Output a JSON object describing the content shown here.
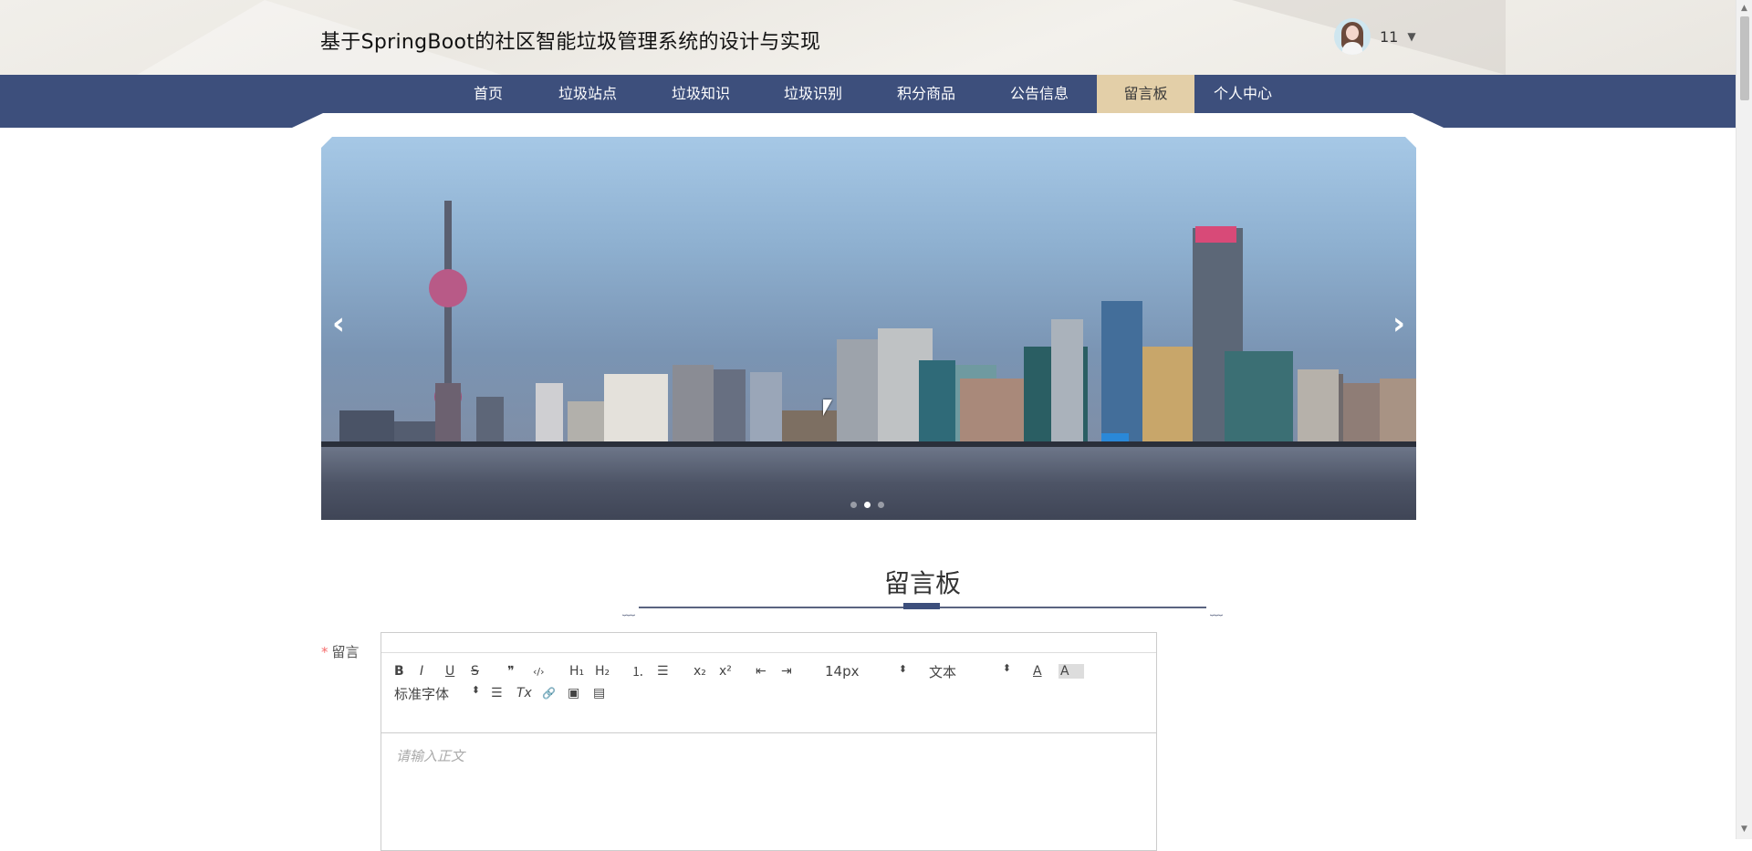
{
  "header": {
    "site_title": "基于SpringBoot的社区智能垃圾管理系统的设计与实现",
    "user_name": "11",
    "caret": "▼"
  },
  "nav": {
    "items": [
      {
        "label": "首页"
      },
      {
        "label": "垃圾站点"
      },
      {
        "label": "垃圾知识"
      },
      {
        "label": "垃圾识别"
      },
      {
        "label": "积分商品"
      },
      {
        "label": "公告信息"
      },
      {
        "label": "留言板",
        "active": true
      },
      {
        "label": "个人中心"
      }
    ]
  },
  "carousel": {
    "prev": "‹",
    "next": "›",
    "slide_count": 3,
    "active_index": 1
  },
  "section": {
    "title": "留言板"
  },
  "form": {
    "label_required": "*",
    "label": "留言",
    "editor": {
      "placeholder": "请输入正文",
      "toolbar_row1": {
        "bold": "B",
        "italic": "I",
        "underline": "U",
        "strike": "S",
        "quote": "❞",
        "code": "‹/›",
        "h1": "H₁",
        "h2": "H₂",
        "ordered_list": "⒈",
        "bullet_list": "☰",
        "subscript": "x₂",
        "superscript": "x²",
        "outdent": "⇤",
        "indent": "⇥",
        "font_size": "14px",
        "text_style": "文本",
        "select_arrow": "⬍",
        "font_color": "A",
        "bg_color": "A"
      },
      "toolbar_row2": {
        "font_family": "标准字体",
        "select_arrow": "⬍",
        "align": "☰",
        "clear_format": "Tx",
        "link": "🔗",
        "image": "▣",
        "video": "▤"
      }
    }
  },
  "colors": {
    "nav_bg": "#3d4f7c",
    "nav_active": "#e3cfa8",
    "required": "#f56c6c"
  }
}
